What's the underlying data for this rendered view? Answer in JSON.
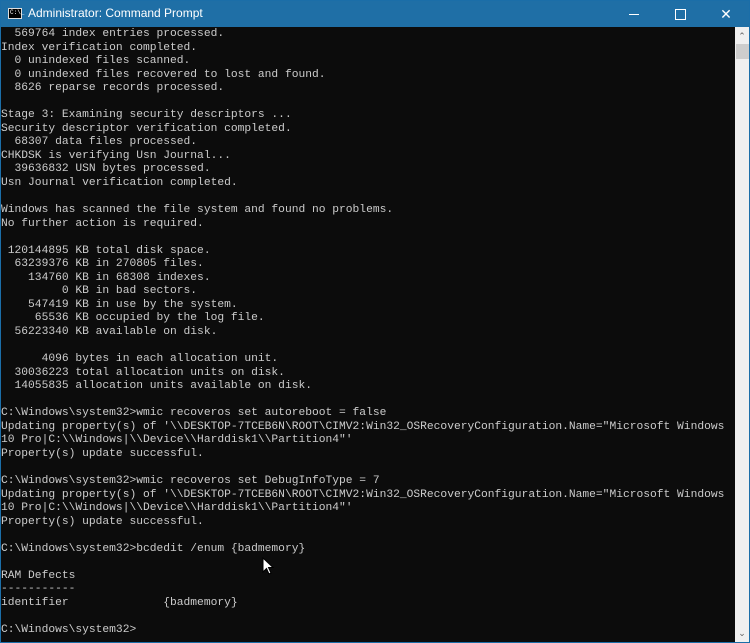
{
  "window": {
    "title": "Administrator: Command Prompt",
    "icon": "cmd-icon",
    "icon_text": "C:\\_",
    "controls": {
      "minimize": "minimize-icon",
      "maximize": "maximize-icon",
      "close": "close-icon",
      "close_glyph": "✕"
    }
  },
  "colors": {
    "titlebar": "#1f6fa6",
    "console_bg": "#0c0c0c",
    "console_text": "#cccccc"
  },
  "scrollbar": {
    "position_fraction": 0.0,
    "up_glyph": "⌃",
    "down_glyph": "⌄"
  },
  "console": {
    "lines": [
      "  569764 index entries processed.",
      "Index verification completed.",
      "  0 unindexed files scanned.",
      "  0 unindexed files recovered to lost and found.",
      "  8626 reparse records processed.",
      "",
      "Stage 3: Examining security descriptors ...",
      "Security descriptor verification completed.",
      "  68307 data files processed.",
      "CHKDSK is verifying Usn Journal...",
      "  39636832 USN bytes processed.",
      "Usn Journal verification completed.",
      "",
      "Windows has scanned the file system and found no problems.",
      "No further action is required.",
      "",
      " 120144895 KB total disk space.",
      "  63239376 KB in 270805 files.",
      "    134760 KB in 68308 indexes.",
      "         0 KB in bad sectors.",
      "    547419 KB in use by the system.",
      "     65536 KB occupied by the log file.",
      "  56223340 KB available on disk.",
      "",
      "      4096 bytes in each allocation unit.",
      "  30036223 total allocation units on disk.",
      "  14055835 allocation units available on disk.",
      "",
      "C:\\Windows\\system32>wmic recoveros set autoreboot = false",
      "Updating property(s) of '\\\\DESKTOP-7TCEB6N\\ROOT\\CIMV2:Win32_OSRecoveryConfiguration.Name=\"Microsoft Windows",
      "10 Pro|C:\\\\Windows|\\\\Device\\\\Harddisk1\\\\Partition4\"'",
      "Property(s) update successful.",
      "",
      "C:\\Windows\\system32>wmic recoveros set DebugInfoType = 7",
      "Updating property(s) of '\\\\DESKTOP-7TCEB6N\\ROOT\\CIMV2:Win32_OSRecoveryConfiguration.Name=\"Microsoft Windows",
      "10 Pro|C:\\\\Windows|\\\\Device\\\\Harddisk1\\\\Partition4\"'",
      "Property(s) update successful.",
      "",
      "C:\\Windows\\system32>bcdedit /enum {badmemory}",
      "",
      "RAM Defects",
      "-----------",
      "identifier              {badmemory}",
      "",
      "C:\\Windows\\system32>"
    ]
  }
}
